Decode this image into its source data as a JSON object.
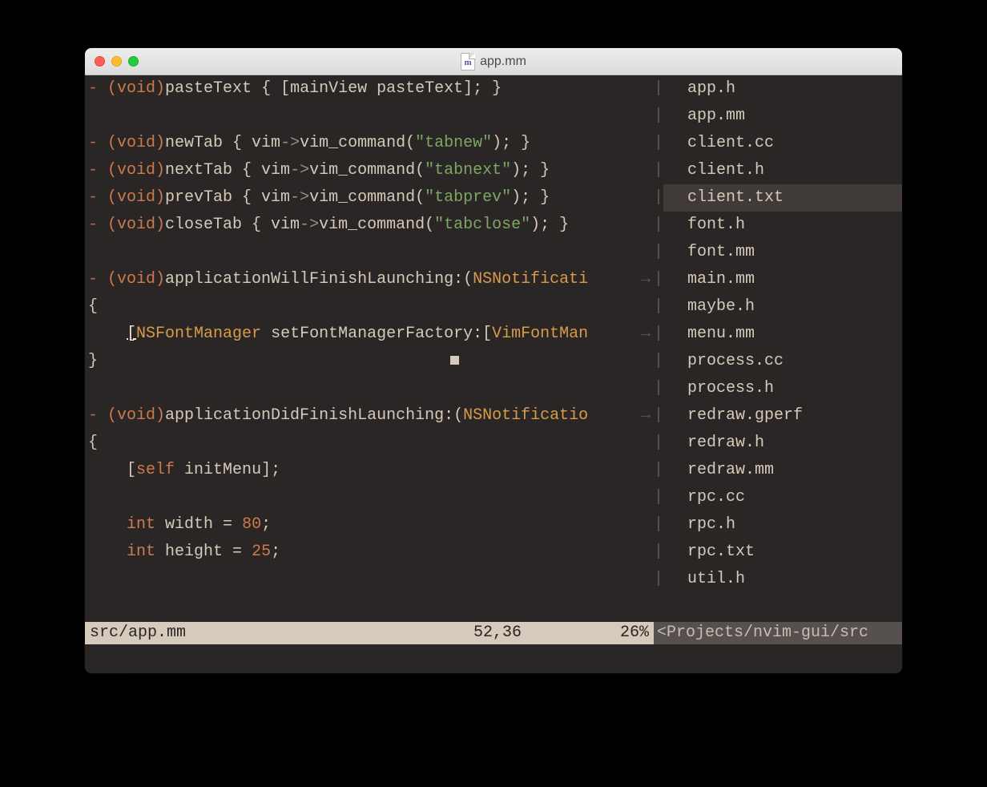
{
  "window": {
    "title": "app.mm",
    "file_icon_letter": "m"
  },
  "code": {
    "lines": [
      {
        "type": "method",
        "dash": "-",
        "sig": "(void)",
        "name": "pasteText",
        "body_open": " { ",
        "call_pre": "[mainView ",
        "call_name": "pasteText",
        "call_post": "]; }"
      },
      {
        "type": "blank"
      },
      {
        "type": "vimcmd",
        "dash": "-",
        "sig": "(void)",
        "name": "newTab",
        "body_open": " { vim",
        "arrow": "->",
        "fn": "vim_command(",
        "str": "\"tabnew\"",
        "close": "); }"
      },
      {
        "type": "vimcmd",
        "dash": "-",
        "sig": "(void)",
        "name": "nextTab",
        "body_open": " { vim",
        "arrow": "->",
        "fn": "vim_command(",
        "str": "\"tabnext\"",
        "close": "); }"
      },
      {
        "type": "vimcmd",
        "dash": "-",
        "sig": "(void)",
        "name": "prevTab",
        "body_open": " { vim",
        "arrow": "->",
        "fn": "vim_command(",
        "str": "\"tabprev\"",
        "close": "); }"
      },
      {
        "type": "vimcmd",
        "dash": "-",
        "sig": "(void)",
        "name": "closeTab",
        "body_open": " { vim",
        "arrow": "->",
        "fn": "vim_command(",
        "str": "\"tabclose\"",
        "close": "); }"
      },
      {
        "type": "blank"
      },
      {
        "type": "sig-wrap",
        "dash": "-",
        "sig": "(void)",
        "name": "applicationWillFinishLaunching:",
        "paren": "(",
        "cls": "NSNotificati",
        "wrap": true
      },
      {
        "type": "brace",
        "text": "{"
      },
      {
        "type": "fontmgr",
        "indent": "    ",
        "open": "[",
        "cls1": "NSFontManager",
        "mid": " setFontManagerFactory:",
        "open2": "[",
        "cls2": "VimFontMan",
        "wrap": true,
        "cursor": true
      },
      {
        "type": "brace",
        "text": "}"
      },
      {
        "type": "blank"
      },
      {
        "type": "sig-wrap",
        "dash": "-",
        "sig": "(void)",
        "name": "applicationDidFinishLaunching:",
        "paren": "(",
        "cls": "NSNotificatio",
        "wrap": true
      },
      {
        "type": "brace",
        "text": "{"
      },
      {
        "type": "selfcall",
        "indent": "    ",
        "open": "[",
        "self": "self",
        "rest": " initMenu];"
      },
      {
        "type": "blank"
      },
      {
        "type": "decl",
        "indent": "    ",
        "kw": "int",
        "var": " width = ",
        "num": "80",
        "semi": ";"
      },
      {
        "type": "decl",
        "indent": "    ",
        "kw": "int",
        "var": " height = ",
        "num": "25",
        "semi": ";"
      },
      {
        "type": "blank"
      }
    ]
  },
  "files": [
    {
      "name": "app.h",
      "selected": false
    },
    {
      "name": "app.mm",
      "selected": false
    },
    {
      "name": "client.cc",
      "selected": false
    },
    {
      "name": "client.h",
      "selected": false
    },
    {
      "name": "client.txt",
      "selected": true
    },
    {
      "name": "font.h",
      "selected": false
    },
    {
      "name": "font.mm",
      "selected": false
    },
    {
      "name": "main.mm",
      "selected": false
    },
    {
      "name": "maybe.h",
      "selected": false
    },
    {
      "name": "menu.mm",
      "selected": false
    },
    {
      "name": "process.cc",
      "selected": false
    },
    {
      "name": "process.h",
      "selected": false
    },
    {
      "name": "redraw.gperf",
      "selected": false
    },
    {
      "name": "redraw.h",
      "selected": false
    },
    {
      "name": "redraw.mm",
      "selected": false
    },
    {
      "name": "rpc.cc",
      "selected": false
    },
    {
      "name": "rpc.h",
      "selected": false
    },
    {
      "name": "rpc.txt",
      "selected": false
    },
    {
      "name": "util.h",
      "selected": false
    }
  ],
  "status": {
    "left_file": "src/app.mm",
    "position": "52,36",
    "percent": "26%",
    "right": "<Projects/nvim-gui/src"
  },
  "wrap_glyph": "→",
  "vsplit_glyph": "|"
}
